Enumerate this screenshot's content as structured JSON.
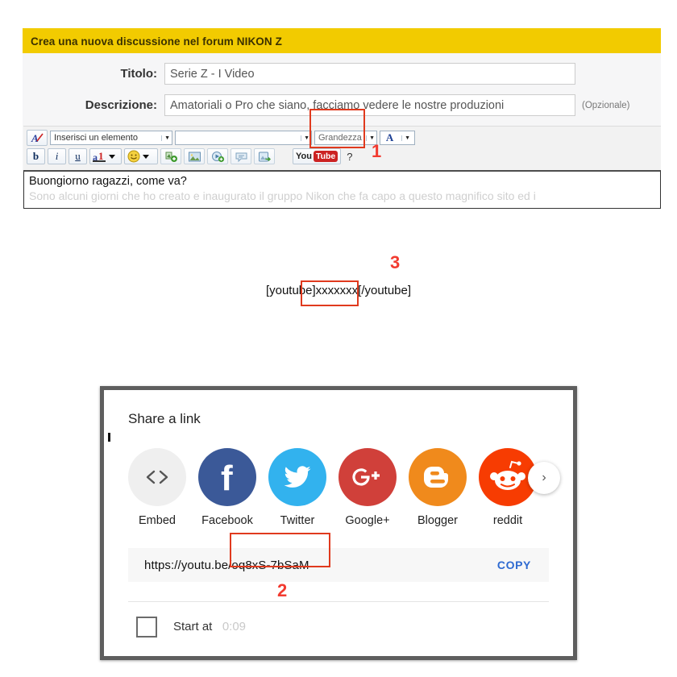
{
  "forum": {
    "banner_title": "Crea una nuova discussione nel forum NIKON Z",
    "fields": [
      {
        "label": "Titolo:",
        "value": "Serie Z - I Video",
        "note": ""
      },
      {
        "label": "Descrizione:",
        "value": "Amatoriali o Pro che siano, facciamo vedere le nostre produzioni",
        "note": "(Opzionale)"
      }
    ],
    "toolbar": {
      "font_icon": "font-style-icon",
      "insert_element_placeholder": "Inserisci un elemento",
      "second_select_value": "",
      "size_select_value": "Grandezza",
      "color_select_value": "A",
      "bold_label": "b",
      "italic_label": "i",
      "underline_label": "u",
      "text_color_label": "a",
      "smiley_label": "smiley-icon",
      "link_label": "insert-link-icon",
      "image_label": "insert-image-icon",
      "media_label": "insert-media-icon",
      "quote_label": "insert-quote-icon",
      "attachment_label": "insert-attachment-icon",
      "youtube_you": "You",
      "youtube_tube": "Tube",
      "help_label": "?"
    },
    "message": {
      "line1": "Buongiorno ragazzi, come va?",
      "line2": "Sono alcuni giorni che ho creato e inaugurato il gruppo Nikon che fa capo a questo magnifico sito ed i"
    },
    "bbcode_snippet": "[youtube]xxxxxxx[/youtube]"
  },
  "markers": {
    "one": "1",
    "two": "2",
    "three": "3"
  },
  "share_dialog": {
    "title": "Share a link",
    "targets": [
      {
        "label": "Embed",
        "icon": "embed-code-icon",
        "color": "#efefef"
      },
      {
        "label": "Facebook",
        "icon": "facebook-icon",
        "color": "#3b5998"
      },
      {
        "label": "Twitter",
        "icon": "twitter-icon",
        "color": "#32b2ee"
      },
      {
        "label": "Google+",
        "icon": "google-plus-icon",
        "color": "#d0403a"
      },
      {
        "label": "Blogger",
        "icon": "blogger-icon",
        "color": "#f08a1c"
      },
      {
        "label": "reddit",
        "icon": "reddit-icon",
        "color": "#f73c02"
      }
    ],
    "next_arrow": "›",
    "url": "https://youtu.be/oq8xS-7bSaM",
    "copy_label": "COPY",
    "start_at_label": "Start at",
    "start_at_time": "0:09",
    "start_at_checked": false
  },
  "colors": {
    "banner": "#f2cb00",
    "marker_red": "#f23b30",
    "highlight_red": "#e03a1e",
    "copy_blue": "#2e6ad1"
  }
}
